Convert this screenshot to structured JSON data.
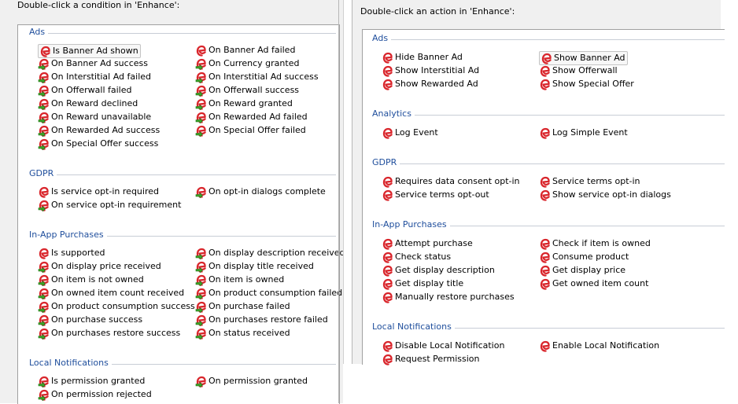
{
  "conditions": {
    "heading": "Double-click a condition in 'Enhance':",
    "groups": [
      {
        "title": "Ads",
        "items": [
          {
            "label": "Is Banner Ad shown",
            "kind": "bool",
            "selected": true
          },
          {
            "label": "On Banner Ad failed",
            "kind": "bool"
          },
          {
            "label": "On Banner Ad success",
            "kind": "trigger"
          },
          {
            "label": "On Currency granted",
            "kind": "trigger"
          },
          {
            "label": "On Interstitial Ad failed",
            "kind": "trigger"
          },
          {
            "label": "On Interstitial Ad success",
            "kind": "trigger"
          },
          {
            "label": "On Offerwall failed",
            "kind": "trigger"
          },
          {
            "label": "On Offerwall success",
            "kind": "trigger"
          },
          {
            "label": "On Reward declined",
            "kind": "trigger"
          },
          {
            "label": "On Reward granted",
            "kind": "trigger"
          },
          {
            "label": "On Reward unavailable",
            "kind": "trigger"
          },
          {
            "label": "On Rewarded Ad failed",
            "kind": "trigger"
          },
          {
            "label": "On Rewarded Ad success",
            "kind": "trigger"
          },
          {
            "label": "On Special Offer failed",
            "kind": "trigger"
          },
          {
            "label": "On Special Offer success",
            "kind": "trigger"
          }
        ]
      },
      {
        "title": "GDPR",
        "items": [
          {
            "label": "Is service opt-in required",
            "kind": "bool"
          },
          {
            "label": "On opt-in dialogs complete",
            "kind": "trigger"
          },
          {
            "label": "On service opt-in requirement",
            "kind": "trigger"
          }
        ]
      },
      {
        "title": "In-App Purchases",
        "items": [
          {
            "label": "Is supported",
            "kind": "bool"
          },
          {
            "label": "On display description received",
            "kind": "trigger"
          },
          {
            "label": "On display price received",
            "kind": "trigger"
          },
          {
            "label": "On display title received",
            "kind": "trigger"
          },
          {
            "label": "On item is not owned",
            "kind": "trigger"
          },
          {
            "label": "On item is owned",
            "kind": "trigger"
          },
          {
            "label": "On owned item count received",
            "kind": "trigger"
          },
          {
            "label": "On product consumption failed",
            "kind": "trigger"
          },
          {
            "label": "On product consumption success",
            "kind": "trigger"
          },
          {
            "label": "On purchase failed",
            "kind": "trigger"
          },
          {
            "label": "On purchase success",
            "kind": "trigger"
          },
          {
            "label": "On purchases restore failed",
            "kind": "trigger"
          },
          {
            "label": "On purchases restore success",
            "kind": "trigger"
          },
          {
            "label": "On status received",
            "kind": "trigger"
          }
        ]
      },
      {
        "title": "Local Notifications",
        "items": [
          {
            "label": "Is permission granted",
            "kind": "trigger"
          },
          {
            "label": "On permission granted",
            "kind": "trigger"
          },
          {
            "label": "On permission rejected",
            "kind": "trigger"
          }
        ]
      }
    ]
  },
  "actions": {
    "heading": "Double-click an action in 'Enhance':",
    "groups": [
      {
        "title": "Ads",
        "items": [
          {
            "label": "Hide Banner Ad",
            "kind": "action"
          },
          {
            "label": "Show Banner Ad",
            "kind": "action",
            "selected": true
          },
          {
            "label": "Show Interstitial Ad",
            "kind": "action"
          },
          {
            "label": "Show Offerwall",
            "kind": "action"
          },
          {
            "label": "Show Rewarded Ad",
            "kind": "action"
          },
          {
            "label": "Show Special Offer",
            "kind": "action"
          }
        ]
      },
      {
        "title": "Analytics",
        "items": [
          {
            "label": "Log Event",
            "kind": "action"
          },
          {
            "label": "Log Simple Event",
            "kind": "action"
          }
        ]
      },
      {
        "title": "GDPR",
        "items": [
          {
            "label": "Requires data consent opt-in",
            "kind": "action"
          },
          {
            "label": "Service terms opt-in",
            "kind": "action"
          },
          {
            "label": "Service terms opt-out",
            "kind": "action"
          },
          {
            "label": "Show service opt-in dialogs",
            "kind": "action"
          }
        ]
      },
      {
        "title": "In-App Purchases",
        "items": [
          {
            "label": "Attempt purchase",
            "kind": "action"
          },
          {
            "label": "Check if item is owned",
            "kind": "action"
          },
          {
            "label": "Check status",
            "kind": "action"
          },
          {
            "label": "Consume product",
            "kind": "action"
          },
          {
            "label": "Get display description",
            "kind": "action"
          },
          {
            "label": "Get display price",
            "kind": "action"
          },
          {
            "label": "Get display title",
            "kind": "action"
          },
          {
            "label": "Get owned item count",
            "kind": "action"
          },
          {
            "label": "Manually restore purchases",
            "kind": "action"
          }
        ]
      },
      {
        "title": "Local Notifications",
        "items": [
          {
            "label": "Disable Local Notification",
            "kind": "action"
          },
          {
            "label": "Enable Local Notification",
            "kind": "action"
          },
          {
            "label": "Request Permission",
            "kind": "action"
          }
        ]
      }
    ]
  },
  "colors": {
    "group_title": "#1f4e9c",
    "plugin_icon": "#d9262c",
    "trigger_arrow": "#3aa629",
    "selection_border": "#c4c4c4"
  },
  "icons": {
    "plugin": "enhance-plugin-icon",
    "trigger": "green-arrow-icon"
  }
}
